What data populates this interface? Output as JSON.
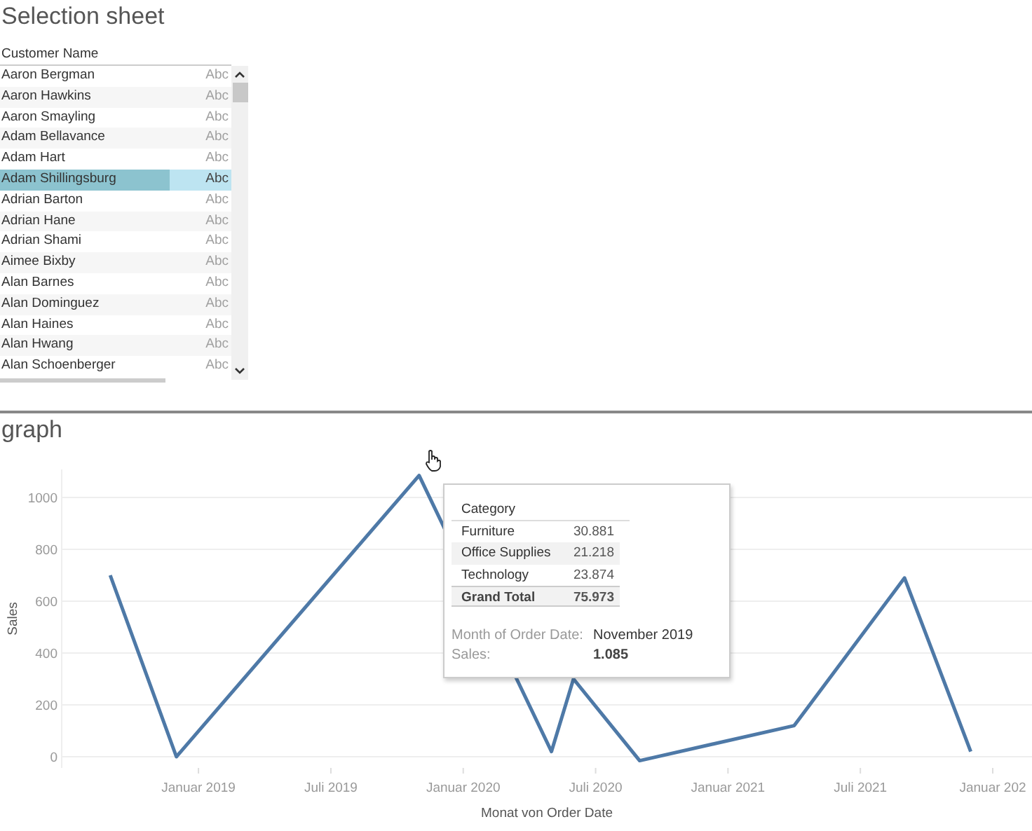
{
  "selection_sheet": {
    "title": "Selection sheet",
    "column_header": "Customer Name",
    "rows": [
      {
        "name": "Aaron Bergman",
        "value": "Abc",
        "selected": false
      },
      {
        "name": "Aaron Hawkins",
        "value": "Abc",
        "selected": false
      },
      {
        "name": "Aaron Smayling",
        "value": "Abc",
        "selected": false
      },
      {
        "name": "Adam Bellavance",
        "value": "Abc",
        "selected": false
      },
      {
        "name": "Adam Hart",
        "value": "Abc",
        "selected": false
      },
      {
        "name": "Adam Shillingsburg",
        "value": "Abc",
        "selected": true
      },
      {
        "name": "Adrian Barton",
        "value": "Abc",
        "selected": false
      },
      {
        "name": "Adrian Hane",
        "value": "Abc",
        "selected": false
      },
      {
        "name": "Adrian Shami",
        "value": "Abc",
        "selected": false
      },
      {
        "name": "Aimee Bixby",
        "value": "Abc",
        "selected": false
      },
      {
        "name": "Alan Barnes",
        "value": "Abc",
        "selected": false
      },
      {
        "name": "Alan Dominguez",
        "value": "Abc",
        "selected": false
      },
      {
        "name": "Alan Haines",
        "value": "Abc",
        "selected": false
      },
      {
        "name": "Alan Hwang",
        "value": "Abc",
        "selected": false
      },
      {
        "name": "Alan Schoenberger",
        "value": "Abc",
        "selected": false
      }
    ]
  },
  "graph": {
    "title": "graph",
    "chart_data": {
      "type": "line",
      "xlabel": "Monat von Order Date",
      "ylabel": "Sales",
      "categories": [
        null,
        null,
        null,
        null,
        "Januar 2019",
        null,
        null,
        null,
        null,
        null,
        "Juli 2019",
        null,
        null,
        null,
        null,
        null,
        "Januar 2020",
        null,
        null,
        null,
        null,
        null,
        "Juli 2020",
        null,
        null,
        null,
        null,
        null,
        "Januar 2021",
        null,
        null,
        null,
        null,
        null,
        "Juli 2021",
        null,
        null,
        null,
        null,
        null,
        "Januar 202"
      ],
      "series": [
        {
          "color": "#4e79a7",
          "values": [
            700,
            null,
            null,
            0,
            null,
            null,
            null,
            null,
            null,
            null,
            null,
            null,
            null,
            null,
            1085,
            null,
            null,
            null,
            null,
            null,
            20,
            300,
            null,
            null,
            -15,
            null,
            null,
            null,
            null,
            null,
            null,
            120,
            null,
            null,
            null,
            null,
            690,
            null,
            null,
            20,
            null
          ]
        }
      ],
      "ylim": [
        -43,
        1108
      ],
      "grid": true,
      "yticks": [
        0,
        200,
        400,
        600,
        800,
        1000
      ]
    },
    "tooltip": {
      "table_header": "Category",
      "rows": [
        {
          "label": "Furniture",
          "value": "30.881",
          "kind": "item"
        },
        {
          "label": "Office Supplies",
          "value": "21.218",
          "kind": "item"
        },
        {
          "label": "Technology",
          "value": "23.874",
          "kind": "item"
        },
        {
          "label": "Grand Total",
          "value": "75.973",
          "kind": "total"
        }
      ],
      "fields": [
        {
          "label": "Month of Order Date:",
          "value": "November 2019"
        },
        {
          "label": "Sales:",
          "value": "1.085"
        }
      ]
    }
  }
}
